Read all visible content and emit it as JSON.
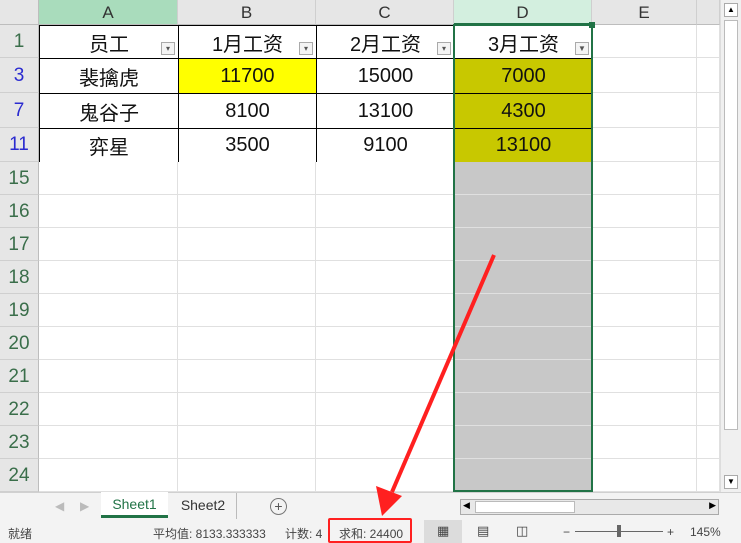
{
  "columns": [
    "A",
    "B",
    "C",
    "D",
    "E"
  ],
  "rows": [
    {
      "num": "1",
      "cells": [
        "员工",
        "1月工资",
        "2月工资",
        "3月工资"
      ]
    },
    {
      "num": "3",
      "cells": [
        "裴擒虎",
        "11700",
        "15000",
        "7000"
      ]
    },
    {
      "num": "7",
      "cells": [
        "鬼谷子",
        "8100",
        "13100",
        "4300"
      ]
    },
    {
      "num": "11",
      "cells": [
        "弈星",
        "3500",
        "9100",
        "13100"
      ]
    }
  ],
  "empty_rows": [
    "15",
    "16",
    "17",
    "18",
    "19",
    "20",
    "21",
    "22",
    "23",
    "24"
  ],
  "sheets": [
    "Sheet1",
    "Sheet2"
  ],
  "status": {
    "ready": "就绪",
    "average": "平均值: 8133.333333",
    "count": "计数: 4",
    "sum": "求和: 24400",
    "zoom": "145%"
  },
  "colors": {
    "yellow": "#ffff00",
    "olive": "#c8c800",
    "grey": "#c8c8c8",
    "annotation": "#ff2020"
  }
}
